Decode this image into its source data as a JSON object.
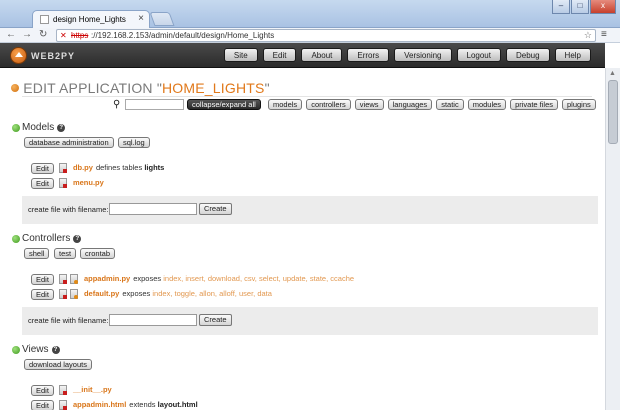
{
  "browser": {
    "tab_title": "design Home_Lights",
    "tab_close": "×",
    "url_proto": "https",
    "url_rest": "://192.168.2.153/admin/default/design/Home_Lights",
    "back_icon": "←",
    "forward_icon": "→",
    "reload_icon": "↻",
    "star_icon": "☆",
    "menu_icon": "≡",
    "win_min": "–",
    "win_max": "□",
    "win_close": "x"
  },
  "header": {
    "brand": "WEB2PY",
    "nav": [
      "Site",
      "Edit",
      "About",
      "Errors",
      "Versioning",
      "Logout",
      "Debug",
      "Help"
    ]
  },
  "page": {
    "title_prefix": "EDIT APPLICATION \"",
    "app_name": "HOME_LIGHTS",
    "title_suffix": "\"",
    "search_icon": "⚲",
    "search_value": "",
    "collapse_label": "collapse/expand all",
    "tabs": [
      "models",
      "controllers",
      "views",
      "languages",
      "static",
      "modules",
      "private files",
      "plugins"
    ]
  },
  "models": {
    "heading": "Models",
    "help": "?",
    "buttons": [
      "database administration",
      "sql.log"
    ],
    "files": [
      {
        "edit": "Edit",
        "name": "db.py",
        "desc": "defines tables",
        "strong": "lights"
      },
      {
        "edit": "Edit",
        "name": "menu.py",
        "desc": "",
        "strong": ""
      }
    ],
    "create_label": "create file with filename:",
    "create_value": "",
    "create_button": "Create"
  },
  "controllers": {
    "heading": "Controllers",
    "help": "?",
    "buttons": [
      "shell",
      "test",
      "crontab"
    ],
    "files": [
      {
        "edit": "Edit",
        "name": "appadmin.py",
        "exposes": "exposes",
        "links": "index, insert, download, csv, select, update, state, ccache"
      },
      {
        "edit": "Edit",
        "name": "default.py",
        "exposes": "exposes",
        "links": "index, toggle, allon, alloff, user, data"
      }
    ],
    "create_label": "create file with filename:",
    "create_value": "",
    "create_button": "Create"
  },
  "views": {
    "heading": "Views",
    "help": "?",
    "buttons": [
      "download layouts"
    ],
    "files": [
      {
        "edit": "Edit",
        "name": "__init__.py",
        "desc": "",
        "strong": ""
      },
      {
        "edit": "Edit",
        "name": "appadmin.html",
        "desc": "extends",
        "strong": "layout.html"
      }
    ]
  },
  "scrollbar": {
    "up_arrow": "▲"
  }
}
